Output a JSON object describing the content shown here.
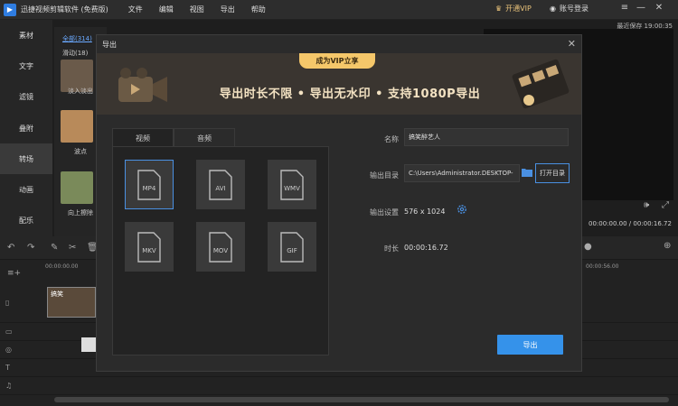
{
  "app": {
    "title": "迅捷视频剪辑软件 (免费版)",
    "menu": [
      "文件",
      "编辑",
      "视图",
      "导出",
      "帮助"
    ],
    "vip_label": "开通VIP",
    "login_label": "账号登录",
    "saved_time": "最近保存 19:00:35",
    "accent_color": "#3592ea"
  },
  "sidebar": {
    "items": [
      {
        "label": "素材"
      },
      {
        "label": "文字"
      },
      {
        "label": "滤镜"
      },
      {
        "label": "叠附"
      },
      {
        "label": "转场"
      },
      {
        "label": "动画"
      },
      {
        "label": "配乐"
      }
    ],
    "active_index": 4
  },
  "media": {
    "filter_all": "全部(314)",
    "filter_scroll": "滑动(18)",
    "items": [
      {
        "label": "淡入淡出"
      },
      {
        "label": "波点"
      },
      {
        "label": "向上擦除"
      }
    ]
  },
  "preview": {
    "timecode": "00:00:00.00 / 00:00:16.72"
  },
  "timeline": {
    "ruler_start": "00:00:00.00",
    "ruler_end": "00:00:56.00",
    "clip_label": "搞笑"
  },
  "dialog": {
    "title": "导出",
    "banner": {
      "badge": "成为VIP立享",
      "text": "导出时长不限 • 导出无水印 • 支持1080P导出"
    },
    "tabs": [
      "视频",
      "音频"
    ],
    "formats": [
      "MP4",
      "AVI",
      "WMV",
      "MKV",
      "MOV",
      "GIF"
    ],
    "selected_format": "MP4",
    "fields": {
      "name_label": "名称",
      "name_value": "搞笑醉艺人",
      "dir_label": "输出目录",
      "dir_value": "C:\\Users\\Administrator.DESKTOP-",
      "open_dir_label": "打开目录",
      "settings_label": "输出设置",
      "settings_value": "576 x 1024",
      "duration_label": "时长",
      "duration_value": "00:00:16.72"
    },
    "export_label": "导出"
  }
}
